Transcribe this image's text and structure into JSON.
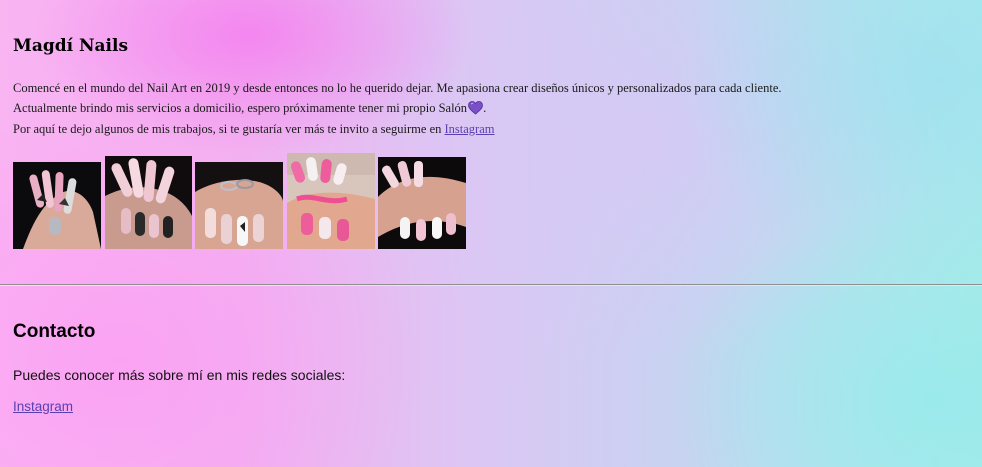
{
  "about": {
    "title": "Magdí Nails",
    "line1": "Comencé en el mundo del Nail Art en 2019 y desde entonces no lo he querido dejar. Me apasiona crear diseños únicos y personalizados para cada cliente.",
    "line2_text": "Actualmente brindo mis servicios a domicilio, espero próximamente tener mi propio Salón",
    "line2_end": ".",
    "line3_text": "Por aquí te dejo algunos de mis trabajos, si te gustaría ver más te invito a seguirme en ",
    "line3_link": "Instagram",
    "heart_icon": "purple-heart-emoji"
  },
  "gallery": {
    "photos": [
      {
        "name": "nail-photo-1",
        "description_icon": "nail-art-photo"
      },
      {
        "name": "nail-photo-2",
        "description_icon": "nail-art-photo"
      },
      {
        "name": "nail-photo-3",
        "description_icon": "nail-art-photo"
      },
      {
        "name": "nail-photo-4",
        "description_icon": "nail-art-photo"
      },
      {
        "name": "nail-photo-5",
        "description_icon": "nail-art-photo"
      }
    ]
  },
  "contact": {
    "title": "Contacto",
    "text": "Puedes conocer más sobre mí en mis redes sociales:",
    "link": "Instagram"
  },
  "colors": {
    "link": "#5a3fb0",
    "heart": "#7b4fc8",
    "background_left": "#f9b4f2",
    "background_right": "#a8eaea"
  }
}
